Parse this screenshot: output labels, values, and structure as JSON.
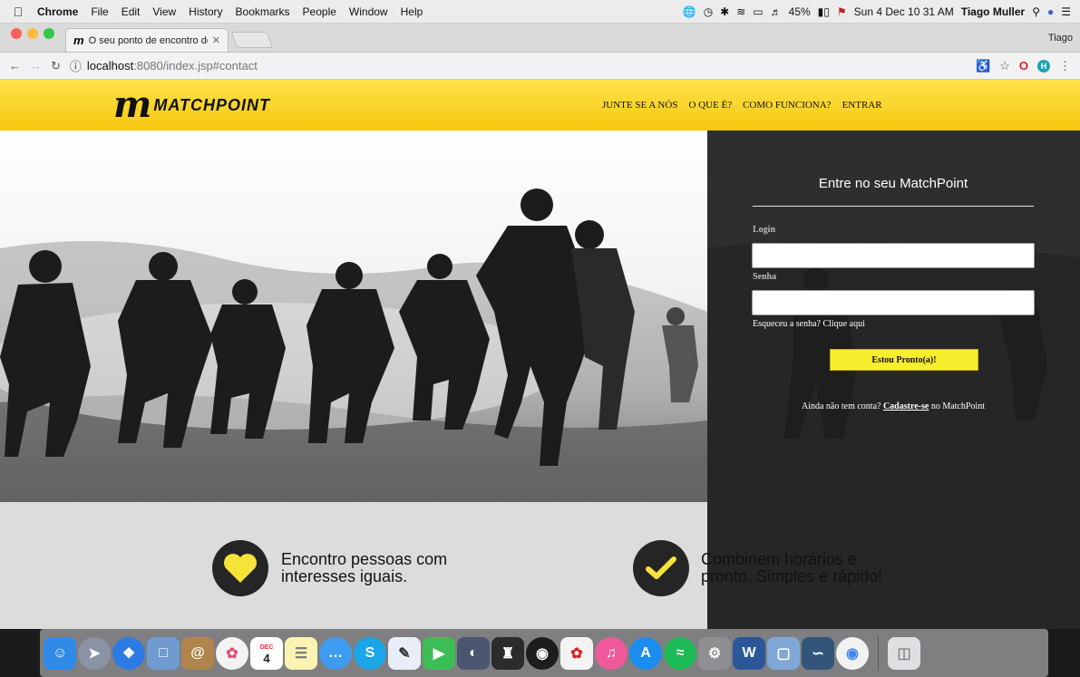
{
  "menubar": {
    "app_name": "Chrome",
    "items": [
      "File",
      "Edit",
      "View",
      "History",
      "Bookmarks",
      "People",
      "Window",
      "Help"
    ],
    "battery": "45%",
    "datetime": "Sun 4 Dec 10 31 AM",
    "user": "Tiago Muller"
  },
  "browser": {
    "tab_title": "O seu ponto de encontro dos e",
    "tab_favicon": "m",
    "profile_name": "Tiago",
    "url_host": "localhost",
    "url_rest": ":8080/index.jsp#contact"
  },
  "site": {
    "logo_mark": "m",
    "logo_name": "MATCHPOINT",
    "nav": [
      "JUNTE SE A NÓS",
      "O QUE É?",
      "COMO FUNCIONA?",
      "ENTRAR"
    ]
  },
  "login": {
    "title": "Entre no seu MatchPoint",
    "login_label": "Login",
    "password_label": "Senha",
    "forgot_text": "Esqueceu a senha? Clique aqui",
    "submit_label": "Estou Pronto(a)!",
    "signup_prefix": "Ainda não tem conta?",
    "signup_link": "Cadastre-se",
    "signup_suffix": "no MatchPoint"
  },
  "features": [
    {
      "icon": "heart-icon",
      "line1": "Encontro pessoas com",
      "line2": "interesses iguais."
    },
    {
      "icon": "check-icon",
      "line1": "Combinem horários e",
      "line2": "pronto. Simples e rápido!"
    }
  ],
  "dock": {
    "calendar_month": "DEC",
    "calendar_day": "4",
    "apps": [
      "finder",
      "launchpad",
      "safari",
      "preview",
      "contacts",
      "photos",
      "calendar",
      "notes",
      "messages",
      "skype",
      "textedit",
      "facetime",
      "dashboard",
      "chess",
      "screenshot",
      "popcorn",
      "itunes",
      "appstore",
      "spotify",
      "systemprefs",
      "word",
      "virtualbox",
      "mysqlworkbench",
      "chrome",
      "trash"
    ]
  },
  "colors": {
    "brand_yellow": "#f9d61e",
    "panel_dark": "#2e2e2e",
    "features_bg": "#dcdcdc",
    "button_yellow": "#f9ee2d"
  }
}
